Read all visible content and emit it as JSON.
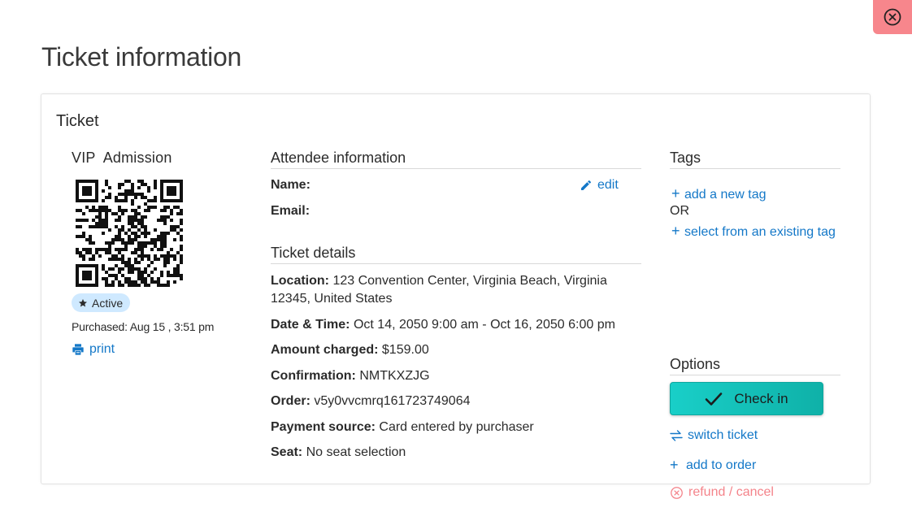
{
  "page": {
    "title": "Ticket information",
    "close_icon": "close-circle-icon"
  },
  "card": {
    "title": "Ticket"
  },
  "ticket": {
    "type": "VIP  Admission",
    "status": "Active",
    "purchased": "Purchased: Aug 15 , 3:51 pm",
    "print_label": "print"
  },
  "attendee": {
    "heading": "Attendee information",
    "name_label": "Name:",
    "email_label": "Email:",
    "edit_label": "edit"
  },
  "details": {
    "heading": "Ticket details",
    "location_label": "Location:",
    "location_value": "123 Convention Center, Virginia Beach, Virginia 12345, United States",
    "datetime_label": "Date & Time:",
    "datetime_value": "Oct 14, 2050 9:00 am - Oct 16, 2050 6:00 pm",
    "amount_label": "Amount charged:",
    "amount_value": "$159.00",
    "confirmation_label": "Confirmation:",
    "confirmation_value": "NMTKXZJG",
    "order_label": "Order:",
    "order_value": "v5y0vvcmrq161723749064",
    "payment_label": "Payment source:",
    "payment_value": "Card entered by purchaser",
    "seat_label": "Seat:",
    "seat_value": "No seat selection"
  },
  "tags": {
    "heading": "Tags",
    "add_new": "add a new tag",
    "or_text": "OR",
    "select_existing": "select from an existing tag"
  },
  "options": {
    "heading": "Options",
    "check_in": "Check in",
    "switch_ticket": "switch ticket",
    "add_to_order": "add to order",
    "refund_cancel": "refund / cancel"
  },
  "colors": {
    "link": "#1478c8",
    "accent_teal": "#19cfc8",
    "danger": "#f4838a",
    "badge_bg": "#cfe9ff",
    "close_bg": "#f7868c"
  }
}
